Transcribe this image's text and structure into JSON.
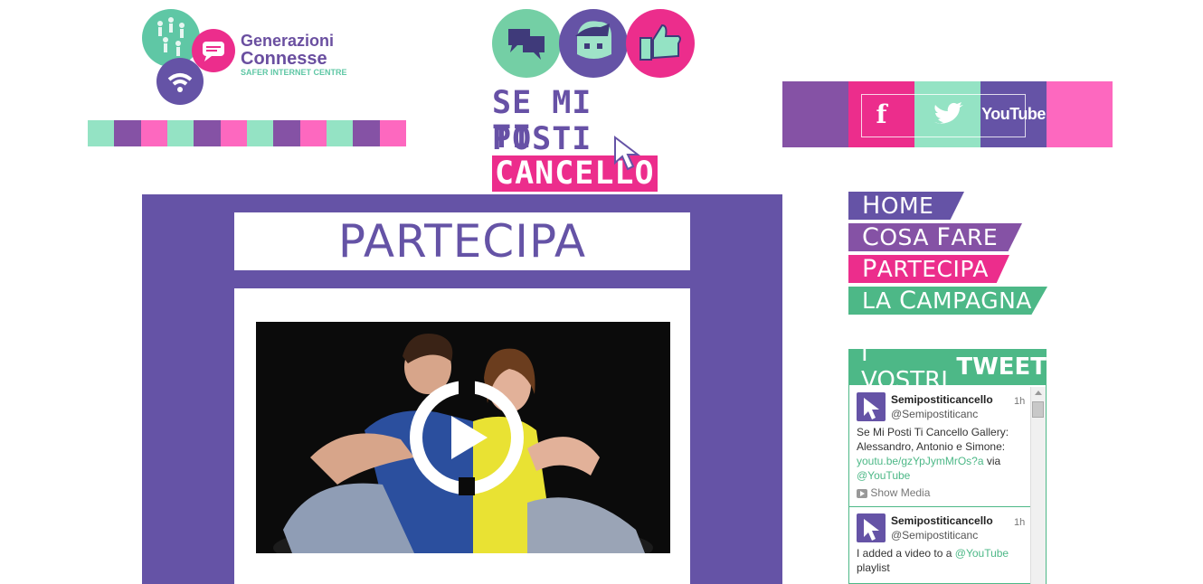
{
  "colors": {
    "purple": "#6553a6",
    "pink": "#ec2d8c",
    "mint": "#94e3c4",
    "green": "#4db887",
    "lightpink": "#fd68bf",
    "lavender": "#8552a5"
  },
  "left_logo": {
    "line1": "Generazioni",
    "line2": "Connesse",
    "line3": "SAFER INTERNET CENTRE"
  },
  "center_logo": {
    "line1": "SE MI POSTI",
    "line2_plain": "TI",
    "line2_highlight": "CANCELLO"
  },
  "social": {
    "facebook": "f",
    "twitter": "twitter-bird",
    "youtube": "YouTube"
  },
  "main": {
    "title": "PARTECIPA"
  },
  "nav": [
    {
      "first": "H",
      "rest": "OME",
      "color": "#6553a6"
    },
    {
      "first": "C",
      "rest": "OSA ",
      "first2": "F",
      "rest2": "ARE",
      "color": "#8552a5"
    },
    {
      "first": "P",
      "rest": "ARTECIPA",
      "color": "#ec2d8c"
    },
    {
      "first": "LA ",
      "rest": "",
      "first2": "C",
      "rest2": "AMPAGNA",
      "color": "#4db887"
    }
  ],
  "tweets_header": {
    "light": "I VOSTRI",
    "bold": "TWEET"
  },
  "tweets": [
    {
      "name": "Semipostiticancello",
      "handle": "@Semipostiticanc",
      "time": "1h",
      "text": "Se Mi Posti Ti Cancello Gallery: Alessandro, Antonio e Simone:",
      "link": "youtu.be/gzYpJymMrOs?a",
      "via": "via",
      "mention": "@YouTube",
      "media": "Show Media"
    },
    {
      "name": "Semipostiticancello",
      "handle": "@Semipostiticanc",
      "time": "1h",
      "text": "I added a video to a",
      "mention": "@YouTube",
      "text2": "playlist"
    }
  ]
}
